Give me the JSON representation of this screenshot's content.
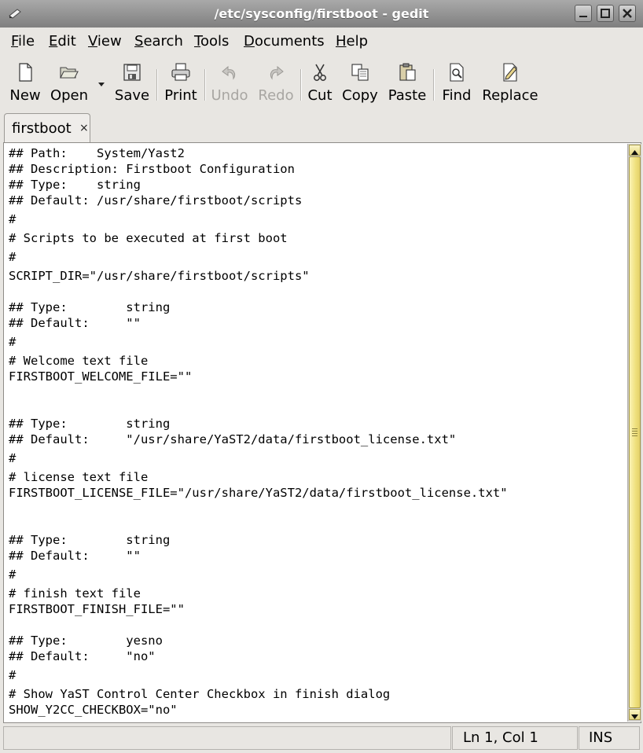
{
  "window": {
    "title": "/etc/sysconfig/firstboot - gedit"
  },
  "menubar": {
    "items": [
      {
        "mnemonic": "F",
        "rest": "ile"
      },
      {
        "mnemonic": "E",
        "rest": "dit"
      },
      {
        "mnemonic": "V",
        "rest": "iew"
      },
      {
        "mnemonic": "S",
        "rest": "earch"
      },
      {
        "mnemonic": "T",
        "rest": "ools"
      },
      {
        "mnemonic": "D",
        "rest": "ocuments"
      },
      {
        "mnemonic": "H",
        "rest": "elp"
      }
    ]
  },
  "toolbar": {
    "new": "New",
    "open": "Open",
    "save": "Save",
    "print": "Print",
    "undo": "Undo",
    "redo": "Redo",
    "cut": "Cut",
    "copy": "Copy",
    "paste": "Paste",
    "find": "Find",
    "replace": "Replace"
  },
  "tabs": [
    {
      "label": "firstboot",
      "close": "×"
    }
  ],
  "editor": {
    "lines": [
      "## Path:    System/Yast2",
      "## Description: Firstboot Configuration",
      "## Type:    string",
      "## Default: /usr/share/firstboot/scripts",
      "#",
      "# Scripts to be executed at first boot",
      "#",
      "SCRIPT_DIR=\"/usr/share/firstboot/scripts\"",
      "",
      "## Type:        string",
      "## Default:     \"\"",
      "#",
      "# Welcome text file",
      "FIRSTBOOT_WELCOME_FILE=\"\"",
      "",
      "",
      "## Type:        string",
      "## Default:     \"/usr/share/YaST2/data/firstboot_license.txt\"",
      "#",
      "# license text file",
      "FIRSTBOOT_LICENSE_FILE=\"/usr/share/YaST2/data/firstboot_license.txt\"",
      "",
      "",
      "## Type:        string",
      "## Default:     \"\"",
      "#",
      "# finish text file",
      "FIRSTBOOT_FINISH_FILE=\"\"",
      "",
      "## Type:        yesno",
      "## Default:     \"no\"",
      "#",
      "# Show YaST Control Center Checkbox in finish dialog",
      "SHOW_Y2CC_CHECKBOX=\"no\""
    ]
  },
  "statusbar": {
    "message": "",
    "position": "Ln 1, Col 1",
    "mode": "INS"
  }
}
